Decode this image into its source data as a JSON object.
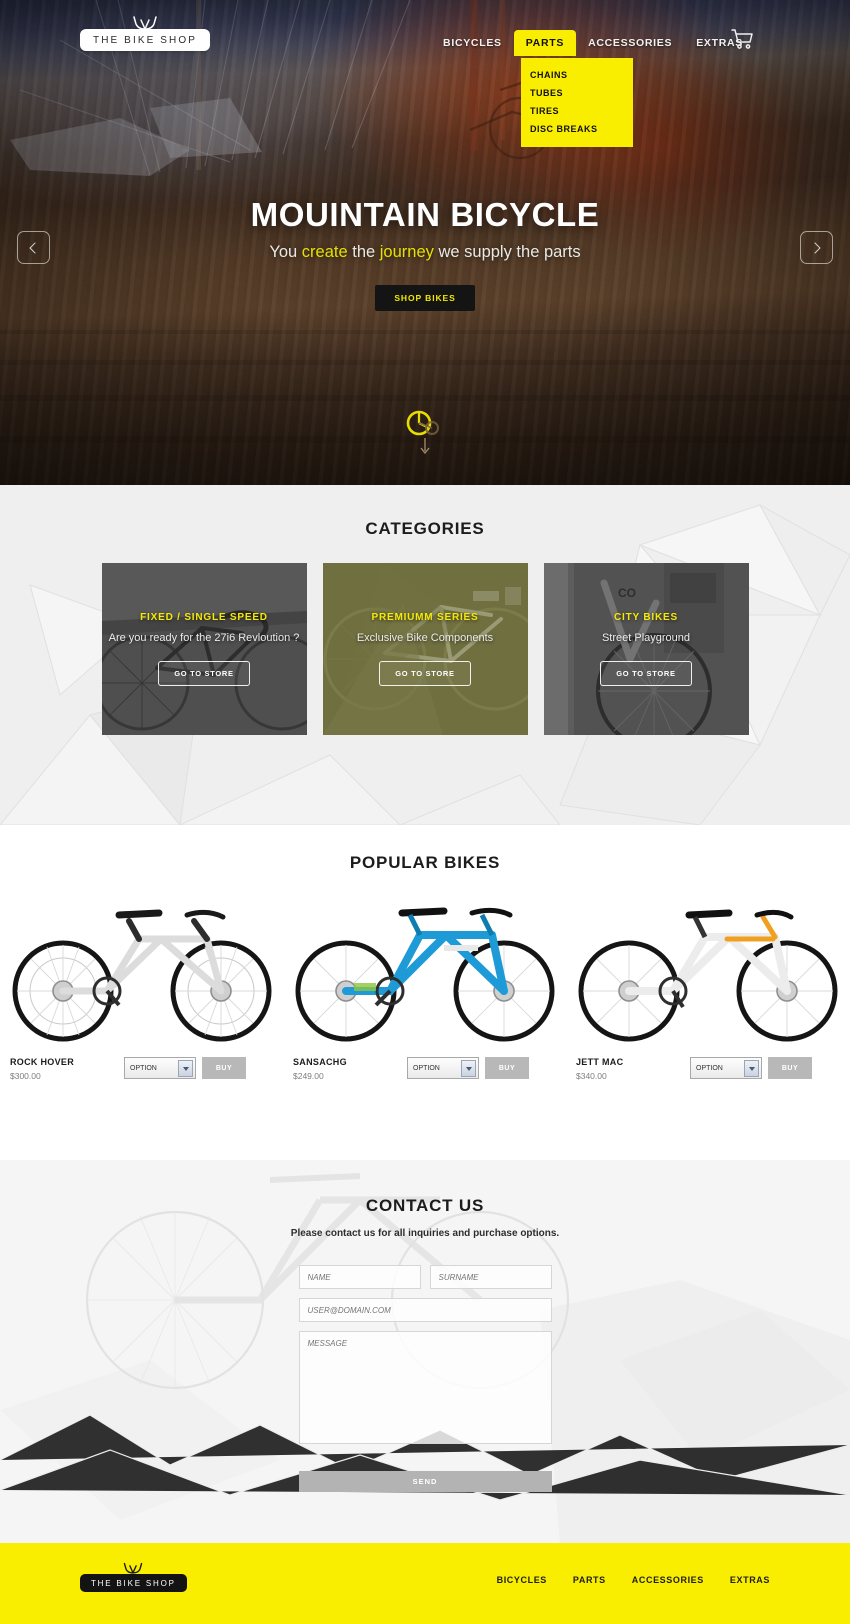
{
  "brand": {
    "name": "THE BIKE SHOP",
    "accent_yellow": "#faee00",
    "dark": "#141414"
  },
  "header": {
    "nav": [
      {
        "label": "BICYCLES",
        "active": false
      },
      {
        "label": "PARTS",
        "active": true
      },
      {
        "label": "ACCESSORIES",
        "active": false
      },
      {
        "label": "EXTRAS",
        "active": false
      }
    ],
    "cart_icon": "shopping-cart-icon",
    "dropdown": {
      "parent": "PARTS",
      "items": [
        "CHAINS",
        "TUBES",
        "TIRES",
        "DISC BREAKS"
      ]
    }
  },
  "hero": {
    "title": "MOUINTAIN BICYCLE",
    "subtitle_parts": [
      {
        "text": "You ",
        "highlight": false
      },
      {
        "text": "create",
        "highlight": true
      },
      {
        "text": " the ",
        "highlight": false
      },
      {
        "text": "journey",
        "highlight": true
      },
      {
        "text": " we supply the parts",
        "highlight": false
      }
    ],
    "cta_label": "SHOP BIKES",
    "prev_icon": "chevron-left-icon",
    "next_icon": "chevron-right-icon",
    "scroll_icon": "bike-wheel-scroll-down-icon"
  },
  "categories": {
    "title": "CATEGORIES",
    "cards": [
      {
        "label": "FIXED / SINGLE SPEED",
        "desc": "Are you ready for the 27i6 Revloution ?",
        "button": "GO TO STORE",
        "tint": "#3a3a3a"
      },
      {
        "label": "PREMIUMM SERIES",
        "desc": "Exclusive Bike Components",
        "button": "GO TO STORE",
        "tint": "#7c7c44"
      },
      {
        "label": "CITY BIKES",
        "desc": "Street Playground",
        "button": "GO TO STORE",
        "tint": "#4a4a4a"
      }
    ]
  },
  "popular": {
    "title": "POPULAR BIKES",
    "products": [
      {
        "name": "ROCK HOVER",
        "price": "$300.00",
        "option_label": "OPTION",
        "buy_label": "BUY",
        "frame_color": "#d8d8d8",
        "accent_color": "#2b2b2b"
      },
      {
        "name": "SANSACHG",
        "price": "$249.00",
        "option_label": "OPTION",
        "buy_label": "BUY",
        "frame_color": "#1e9bd7",
        "accent_color": "#0f7cb0"
      },
      {
        "name": "JETT MAC",
        "price": "$340.00",
        "option_label": "OPTION",
        "buy_label": "BUY",
        "frame_color": "#ececec",
        "accent_color": "#f0a020"
      }
    ]
  },
  "contact": {
    "title": "CONTACT US",
    "subtitle": "Please contact us for all inquiries and purchase options.",
    "fields": {
      "name_placeholder": "NAME",
      "surname_placeholder": "SURNAME",
      "email_placeholder": "USER@DOMAIN.COM",
      "message_placeholder": "MESSAGE"
    },
    "send_label": "SEND"
  },
  "footer": {
    "logo": "THE BIKE SHOP",
    "links": [
      "BICYCLES",
      "PARTS",
      "ACCESSORIES",
      "EXTRAS"
    ]
  }
}
